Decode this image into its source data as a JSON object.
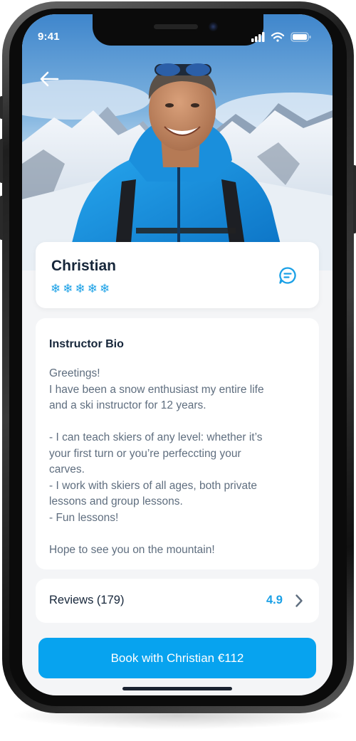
{
  "status_bar": {
    "time": "9:41",
    "icons": [
      "signal-icon",
      "wifi-icon",
      "battery-icon"
    ]
  },
  "header": {
    "back_icon": "back-arrow-icon"
  },
  "instructor": {
    "name": "Christian",
    "rating_icon": "snowflake-icon",
    "rating_icon_glyph": "❄",
    "rating_count": 5,
    "message_icon": "chat-bubble-icon"
  },
  "bio": {
    "title": "Instructor Bio",
    "lines": [
      "Greetings!",
      "I have been a snow enthusiast my entire life",
      "and a ski instructor for 12 years.",
      "",
      "- I can teach skiers of any level: whether it’s",
      "your first turn or you’re perfeccting your",
      "carves.",
      "- I work with skiers of all ages, both private",
      "lessons and group lessons.",
      "- Fun lessons!",
      "",
      "Hope to see you on the mountain!"
    ]
  },
  "reviews": {
    "label": "Reviews (179)",
    "score": "4.9",
    "chevron_icon": "chevron-right-icon"
  },
  "cta": {
    "label": "Book with Christian €112"
  },
  "colors": {
    "accent": "#07a3ef",
    "text_dark": "#16263a",
    "text_muted": "#5f6e7f",
    "background": "#f4f5f7",
    "card": "#ffffff"
  }
}
